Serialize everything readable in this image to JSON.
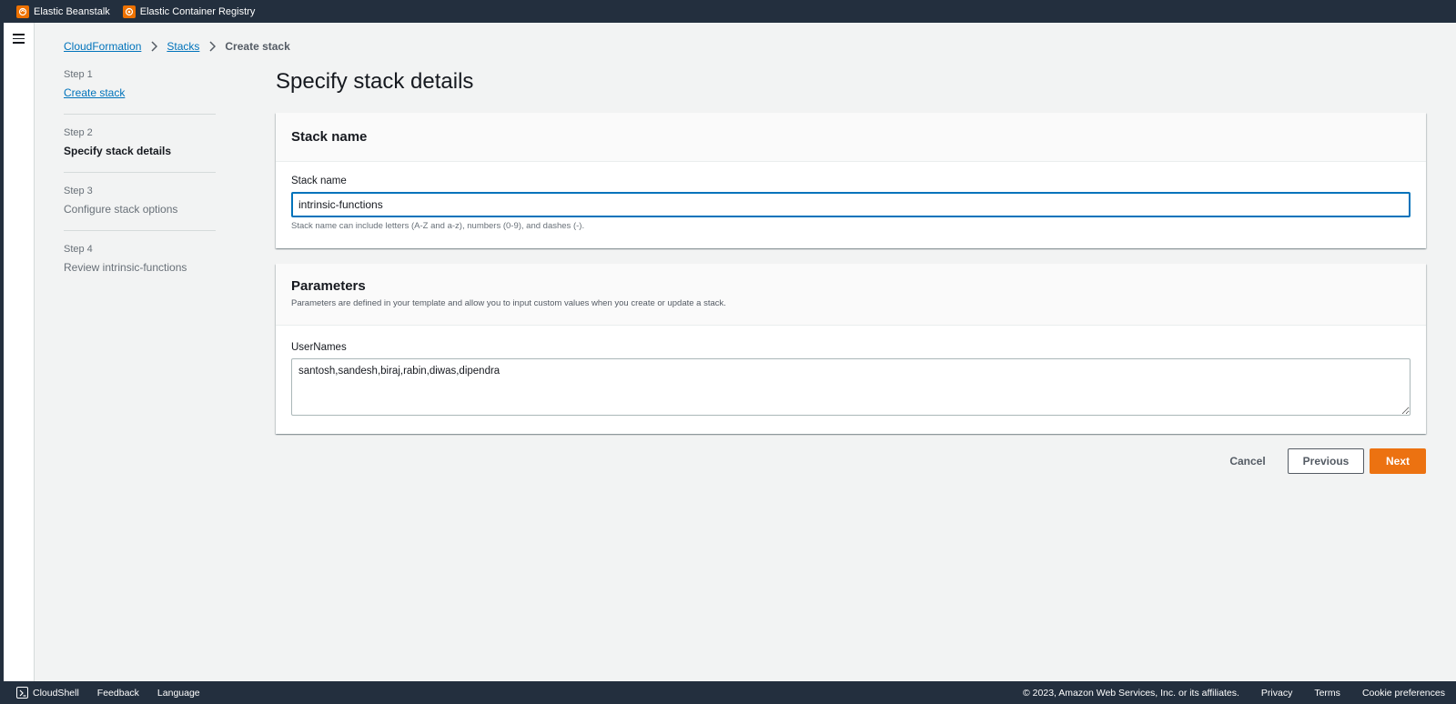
{
  "topbar": {
    "favorites": [
      {
        "label": "Elastic Beanstalk",
        "icon": "elastic-beanstalk-icon"
      },
      {
        "label": "Elastic Container Registry",
        "icon": "elastic-container-registry-icon"
      }
    ]
  },
  "breadcrumb": {
    "items": [
      "CloudFormation",
      "Stacks"
    ],
    "current": "Create stack"
  },
  "steps": [
    {
      "num": "Step 1",
      "title": "Create stack",
      "state": "link"
    },
    {
      "num": "Step 2",
      "title": "Specify stack details",
      "state": "active"
    },
    {
      "num": "Step 3",
      "title": "Configure stack options",
      "state": "disabled"
    },
    {
      "num": "Step 4",
      "title": "Review intrinsic-functions",
      "state": "disabled"
    }
  ],
  "page": {
    "title": "Specify stack details"
  },
  "stack_name_panel": {
    "header": "Stack name",
    "field_label": "Stack name",
    "value": "intrinsic-functions",
    "constraint": "Stack name can include letters (A-Z and a-z), numbers (0-9), and dashes (-)."
  },
  "parameters_panel": {
    "header": "Parameters",
    "description": "Parameters are defined in your template and allow you to input custom values when you create or update a stack.",
    "field_label": "UserNames",
    "value": "santosh,sandesh,biraj,rabin,diwas,dipendra"
  },
  "actions": {
    "cancel": "Cancel",
    "previous": "Previous",
    "next": "Next"
  },
  "footer": {
    "cloudshell": "CloudShell",
    "feedback": "Feedback",
    "language": "Language",
    "copyright": "© 2023, Amazon Web Services, Inc. or its affiliates.",
    "privacy": "Privacy",
    "terms": "Terms",
    "cookie": "Cookie preferences"
  },
  "colors": {
    "header_bg": "#232f3e",
    "link": "#0073bb",
    "primary_button": "#ec7211",
    "page_bg": "#f2f3f3"
  }
}
